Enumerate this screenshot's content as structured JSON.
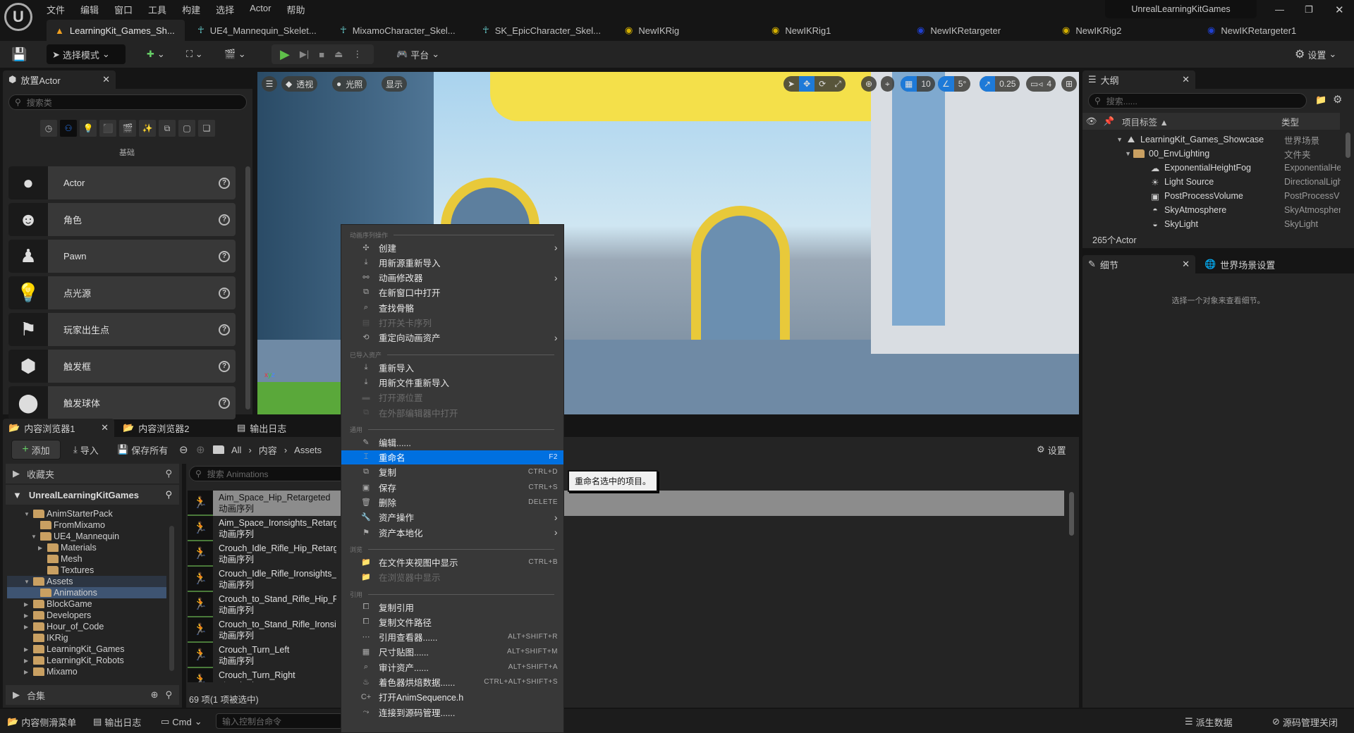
{
  "app": {
    "logo": "unreal-logo",
    "project": "UnrealLearningKitGames"
  },
  "menu": [
    "文件",
    "编辑",
    "窗口",
    "工具",
    "构建",
    "选择",
    "Actor",
    "帮助"
  ],
  "doc_tabs": [
    {
      "label": "LearningKit_Games_Sh...",
      "icon": "level-icon",
      "active": true
    },
    {
      "label": "UE4_Mannequin_Skelet...",
      "icon": "skeleton-icon"
    },
    {
      "label": "MixamoCharacter_Skel...",
      "icon": "skeleton-icon"
    },
    {
      "label": "SK_EpicCharacter_Skel...",
      "icon": "skeleton-icon"
    },
    {
      "label": "NewIKRig",
      "icon": "ikrig-icon"
    },
    {
      "label": "NewIKRig1",
      "icon": "ikrig-icon"
    },
    {
      "label": "NewIKRetargeter",
      "icon": "retargeter-icon"
    },
    {
      "label": "NewIKRig2",
      "icon": "ikrig-icon"
    },
    {
      "label": "NewIKRetargeter1",
      "icon": "retargeter-icon"
    }
  ],
  "toolbar": {
    "mode": "选择模式",
    "platform": "平台",
    "settings": "设置"
  },
  "place_actors": {
    "tab": "放置Actor",
    "search_placeholder": "搜索类",
    "category": "基础",
    "items": [
      {
        "label": "Actor",
        "icon": "sphere-icon"
      },
      {
        "label": "角色",
        "icon": "character-icon"
      },
      {
        "label": "Pawn",
        "icon": "pawn-icon"
      },
      {
        "label": "点光源",
        "icon": "point-light-icon"
      },
      {
        "label": "玩家出生点",
        "icon": "player-start-icon"
      },
      {
        "label": "触发框",
        "icon": "trigger-box-icon"
      },
      {
        "label": "触发球体",
        "icon": "trigger-sphere-icon"
      }
    ]
  },
  "viewport": {
    "menu": "☰",
    "perspective": "透视",
    "lighting": "光照",
    "show": "显示",
    "grid": "10",
    "angle": "5°",
    "scale": "0.25",
    "camera_speed": "4"
  },
  "outliner": {
    "tab": "大纲",
    "search_placeholder": "搜索......",
    "col_label": "项目标签",
    "col_type": "类型",
    "count": "265个Actor",
    "rows": [
      {
        "label": "LearningKit_Games_Showcase",
        "type": "世界场景",
        "indent": 0,
        "icon": "world-icon"
      },
      {
        "label": "00_EnvLighting",
        "type": "文件夹",
        "indent": 1,
        "icon": "folder-icon"
      },
      {
        "label": "ExponentialHeightFog",
        "type": "ExponentialHe",
        "indent": 2,
        "icon": "fog-icon"
      },
      {
        "label": "Light Source",
        "type": "DirectionalLigh",
        "indent": 2,
        "icon": "directional-light-icon"
      },
      {
        "label": "PostProcessVolume",
        "type": "PostProcessV",
        "indent": 2,
        "icon": "post-process-icon"
      },
      {
        "label": "SkyAtmosphere",
        "type": "SkyAtmospher",
        "indent": 2,
        "icon": "sky-atmosphere-icon"
      },
      {
        "label": "SkyLight",
        "type": "SkyLight",
        "indent": 2,
        "icon": "sky-light-icon"
      }
    ]
  },
  "details": {
    "tab": "细节",
    "world_settings_tab": "世界场景设置",
    "empty": "选择一个对象来查看细节。"
  },
  "content_browser": {
    "tabs": [
      "内容浏览器1",
      "内容浏览器2",
      "输出日志"
    ],
    "add": "添加",
    "import": "导入",
    "save_all": "保存所有",
    "path": [
      "All",
      "内容",
      "Assets"
    ],
    "settings": "设置",
    "favorites": "收藏夹",
    "root": "UnrealLearningKitGames",
    "collections": "合集",
    "search_placeholder": "搜索 Animations",
    "count": "69 项(1 项被选中)",
    "tree": [
      {
        "label": "AnimStarterPack",
        "depth": 1,
        "arrow": "▼"
      },
      {
        "label": "FromMixamo",
        "depth": 2,
        "arrow": ""
      },
      {
        "label": "UE4_Mannequin",
        "depth": 2,
        "arrow": "▼"
      },
      {
        "label": "Materials",
        "depth": 3,
        "arrow": "▶"
      },
      {
        "label": "Mesh",
        "depth": 3,
        "arrow": ""
      },
      {
        "label": "Textures",
        "depth": 3,
        "arrow": ""
      },
      {
        "label": "Assets",
        "depth": 1,
        "arrow": "▼",
        "parent_sel": true
      },
      {
        "label": "Animations",
        "depth": 2,
        "arrow": "",
        "selected": true
      },
      {
        "label": "BlockGame",
        "depth": 1,
        "arrow": "▶"
      },
      {
        "label": "Developers",
        "depth": 1,
        "arrow": "▶"
      },
      {
        "label": "Hour_of_Code",
        "depth": 1,
        "arrow": "▶"
      },
      {
        "label": "IKRig",
        "depth": 1,
        "arrow": ""
      },
      {
        "label": "LearningKit_Games",
        "depth": 1,
        "arrow": "▶"
      },
      {
        "label": "LearningKit_Robots",
        "depth": 1,
        "arrow": "▶"
      },
      {
        "label": "Mixamo",
        "depth": 1,
        "arrow": "▶"
      }
    ],
    "assets": [
      {
        "name": "Aim_Space_Hip_Retargeted",
        "type": "动画序列",
        "selected": true
      },
      {
        "name": "Aim_Space_Ironsights_Retargeted",
        "type": "动画序列"
      },
      {
        "name": "Crouch_Idle_Rifle_Hip_Retargeted",
        "type": "动画序列"
      },
      {
        "name": "Crouch_Idle_Rifle_Ironsights_Retargeted",
        "type": "动画序列"
      },
      {
        "name": "Crouch_to_Stand_Rifle_Hip_Retargeted",
        "type": "动画序列"
      },
      {
        "name": "Crouch_to_Stand_Rifle_Ironsights",
        "type": "动画序列"
      },
      {
        "name": "Crouch_Turn_Left",
        "type": "动画序列"
      },
      {
        "name": "Crouch_Turn_Right",
        "type": "动画序列"
      }
    ]
  },
  "context_menu": {
    "sections": [
      {
        "title": "动画序列操作",
        "items": [
          {
            "label": "创建",
            "icon": "create-icon",
            "submenu": true
          },
          {
            "label": "用新源重新导入",
            "icon": "reimport-icon"
          },
          {
            "label": "动画修改器",
            "icon": "modifier-icon",
            "submenu": true
          },
          {
            "label": "在新窗口中打开",
            "icon": "open-window-icon"
          },
          {
            "label": "查找骨骼",
            "icon": "find-skeleton-icon"
          },
          {
            "label": "打开关卡序列",
            "icon": "sequence-icon",
            "disabled": true
          },
          {
            "label": "重定向动画资产",
            "icon": "retarget-icon",
            "submenu": true
          }
        ]
      },
      {
        "title": "已导入资产",
        "items": [
          {
            "label": "重新导入",
            "icon": "reimport-icon"
          },
          {
            "label": "用新文件重新导入",
            "icon": "reimport-icon"
          },
          {
            "label": "打开源位置",
            "icon": "folder-icon",
            "disabled": true
          },
          {
            "label": "在外部编辑器中打开",
            "icon": "open-window-icon",
            "disabled": true
          }
        ]
      },
      {
        "title": "通用",
        "items": [
          {
            "label": "编辑......",
            "icon": "edit-icon"
          },
          {
            "label": "重命名",
            "icon": "rename-icon",
            "shortcut": "F2",
            "highlighted": true
          },
          {
            "label": "复制",
            "icon": "duplicate-icon",
            "shortcut": "CTRL+D"
          },
          {
            "label": "保存",
            "icon": "save-icon",
            "shortcut": "CTRL+S"
          },
          {
            "label": "删除",
            "icon": "delete-icon",
            "shortcut": "DELETE"
          },
          {
            "label": "资产操作",
            "icon": "wrench-icon",
            "submenu": true
          },
          {
            "label": "资产本地化",
            "icon": "flag-icon",
            "submenu": true
          }
        ]
      },
      {
        "title": "浏览",
        "items": [
          {
            "label": "在文件夹视图中显示",
            "icon": "show-folder-icon",
            "shortcut": "CTRL+B"
          },
          {
            "label": "在浏览器中显示",
            "icon": "show-folder-icon",
            "disabled": true
          }
        ]
      },
      {
        "title": "引用",
        "items": [
          {
            "label": "复制引用",
            "icon": "copy-ref-icon"
          },
          {
            "label": "复制文件路径",
            "icon": "copy-path-icon"
          },
          {
            "label": "引用查看器......",
            "icon": "reference-viewer-icon",
            "shortcut": "ALT+SHIFT+R"
          },
          {
            "label": "尺寸贴图......",
            "icon": "size-map-icon",
            "shortcut": "ALT+SHIFT+M"
          },
          {
            "label": "审计资产......",
            "icon": "audit-icon",
            "shortcut": "ALT+SHIFT+A"
          },
          {
            "label": "着色器烘焙数据......",
            "icon": "shader-icon",
            "shortcut": "CTRL+ALT+SHIFT+S"
          },
          {
            "label": "打开AnimSequence.h",
            "icon": "cpp-icon"
          },
          {
            "label": "连接到源码管理......",
            "icon": "source-control-icon"
          }
        ]
      }
    ]
  },
  "tooltip": "重命名选中的项目。",
  "statusbar": {
    "drawer": "内容侧滑菜单",
    "output_log": "输出日志",
    "cmd": "Cmd",
    "console_placeholder": "输入控制台命令",
    "derived_data": "派生数据",
    "source_control": "源码管理关闭"
  },
  "colors": {
    "accent": "#0070e0",
    "panel": "#242424",
    "background": "#151515",
    "folder": "#c9a062"
  }
}
